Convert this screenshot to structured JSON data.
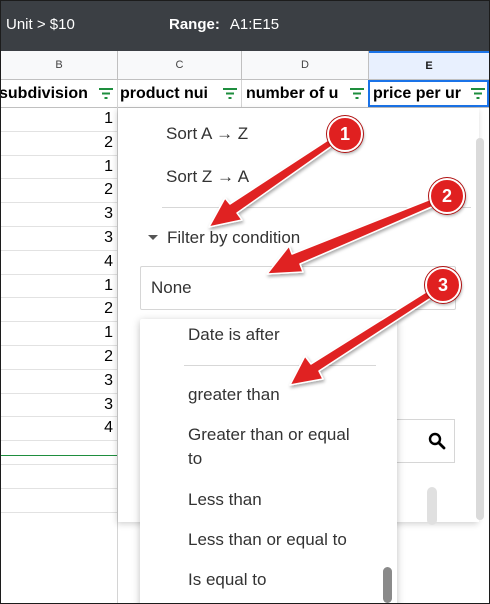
{
  "topbar": {
    "unit_text": "Unit > $10",
    "range_label": "Range:",
    "range_value": "A1:E15"
  },
  "columns": [
    "B",
    "C",
    "D",
    "E"
  ],
  "headers": [
    "subdivision",
    "product nui",
    "number of u",
    "price per ur"
  ],
  "grid_values": [
    "1",
    "2",
    "1",
    "2",
    "3",
    "3",
    "4",
    "1",
    "2",
    "1",
    "2",
    "3",
    "3",
    "4"
  ],
  "filter_panel": {
    "sort_az": "Sort A → Z",
    "sort_za": "Sort Z → A",
    "filter_by_condition": "Filter by condition",
    "condition_value": "None"
  },
  "dropdown_options": [
    "Date is after",
    "greater than",
    "Greater than or equal to",
    "Less than",
    "Less than or equal to",
    "Is equal to"
  ],
  "callouts": [
    "1",
    "2",
    "3"
  ],
  "colors": {
    "callout": "#e02020",
    "accent": "#1a73e8",
    "filter_icon": "#1e8e3e"
  },
  "icons": {
    "filter": "filter-icon",
    "search": "search-icon",
    "expand": "caret-down-icon"
  }
}
